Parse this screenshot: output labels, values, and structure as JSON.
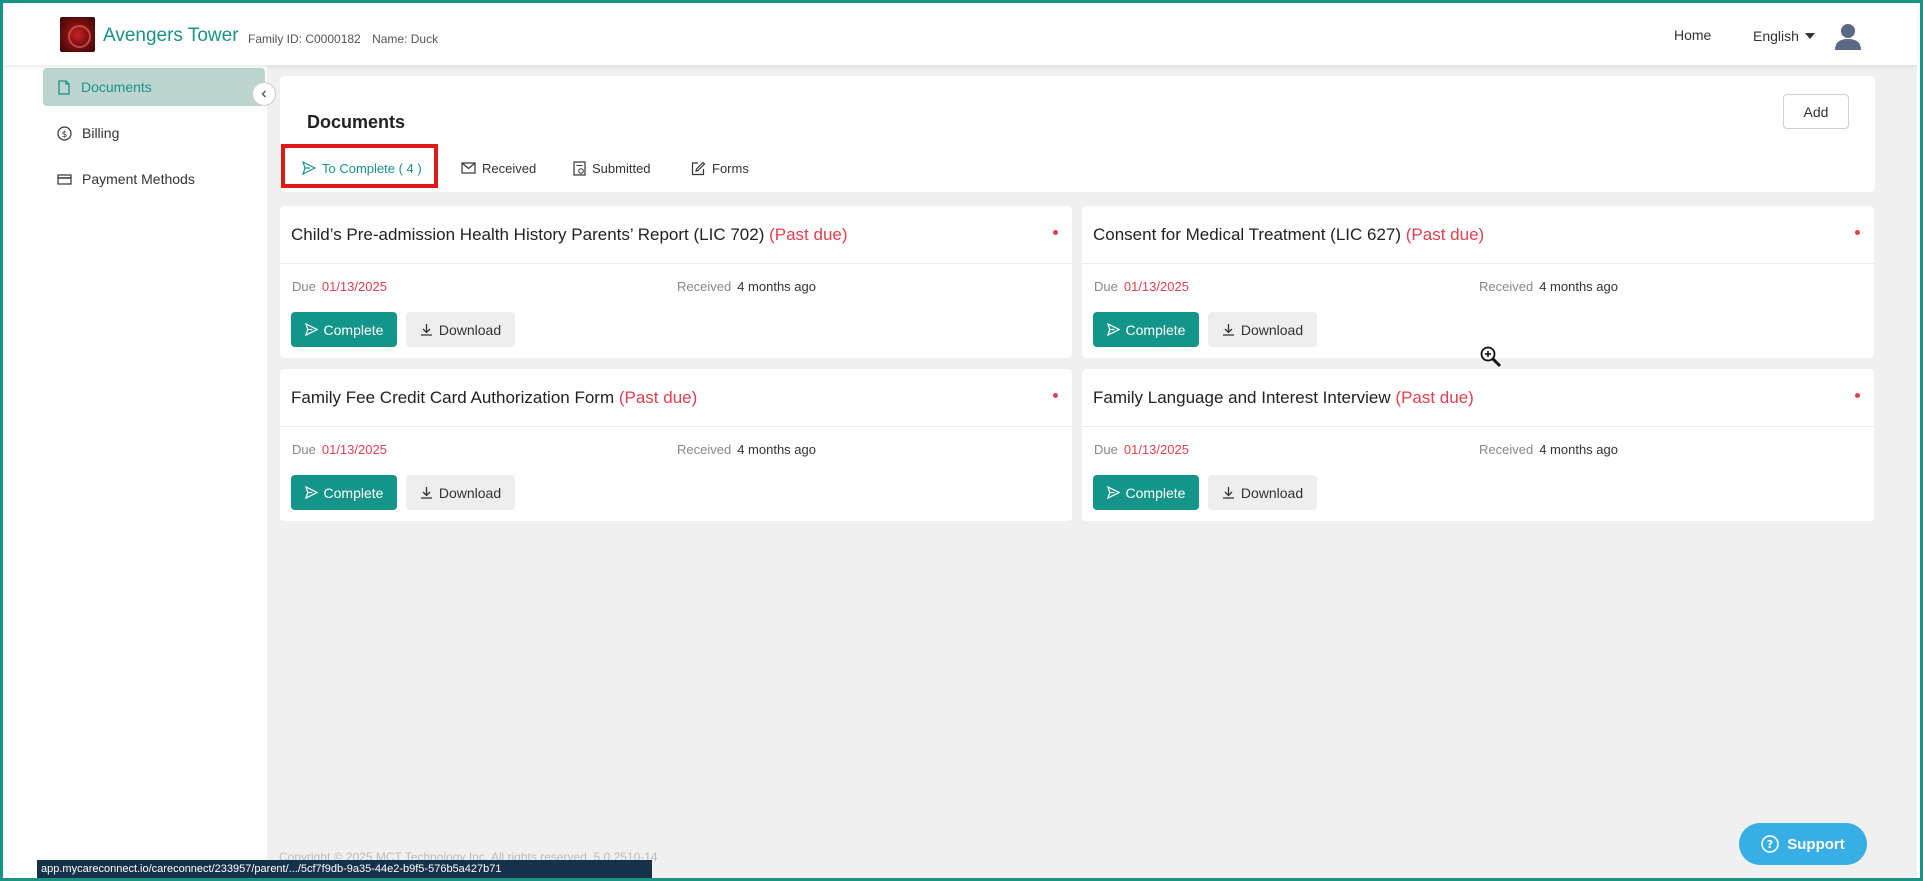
{
  "header": {
    "brand": "Avengers Tower",
    "family_id": "Family ID: C0000182",
    "name": "Name: Duck",
    "home": "Home",
    "language": "English"
  },
  "sidebar": {
    "items": [
      {
        "label": "Documents",
        "icon": "document-icon",
        "active": true
      },
      {
        "label": "Billing",
        "icon": "dollar-icon",
        "active": false
      },
      {
        "label": "Payment Methods",
        "icon": "credit-card-icon",
        "active": false
      }
    ]
  },
  "documents": {
    "title": "Documents",
    "add_label": "Add",
    "tabs": [
      {
        "label": "To Complete ( 4 )",
        "icon": "send-icon",
        "active": true
      },
      {
        "label": "Received",
        "icon": "envelope-icon",
        "active": false
      },
      {
        "label": "Submitted",
        "icon": "submitted-doc-icon",
        "active": false
      },
      {
        "label": "Forms",
        "icon": "edit-icon",
        "active": false
      }
    ],
    "cards": [
      {
        "title": "Child’s Pre-admission Health History Parents’ Report (LIC 702)",
        "status": "(Past due)",
        "due_label": "Due",
        "due": "01/13/2025",
        "received_label": "Received",
        "received": "4 months ago",
        "complete": "Complete",
        "download": "Download"
      },
      {
        "title": "Consent for Medical Treatment (LIC 627)",
        "status": "(Past due)",
        "due_label": "Due",
        "due": "01/13/2025",
        "received_label": "Received",
        "received": "4 months ago",
        "complete": "Complete",
        "download": "Download"
      },
      {
        "title": "Family Fee Credit Card Authorization Form",
        "status": "(Past due)",
        "due_label": "Due",
        "due": "01/13/2025",
        "received_label": "Received",
        "received": "4 months ago",
        "complete": "Complete",
        "download": "Download"
      },
      {
        "title": "Family Language and Interest Interview",
        "status": "(Past due)",
        "due_label": "Due",
        "due": "01/13/2025",
        "received_label": "Received",
        "received": "4 months ago",
        "complete": "Complete",
        "download": "Download"
      }
    ]
  },
  "footer": {
    "copyright": "Copyright © 2025 MCT Technology Inc. All rights reserved. 5.0.2510-14",
    "status_url": "app.mycareconnect.io/careconnect/233957/parent/.../5cf7f9db-9a35-44e2-b9f5-576b5a427b71",
    "support": "Support"
  },
  "colors": {
    "accent": "#1a9284",
    "button": "#14958a",
    "past_due": "#e04050",
    "highlight": "#e01919",
    "support": "#37aee5"
  }
}
